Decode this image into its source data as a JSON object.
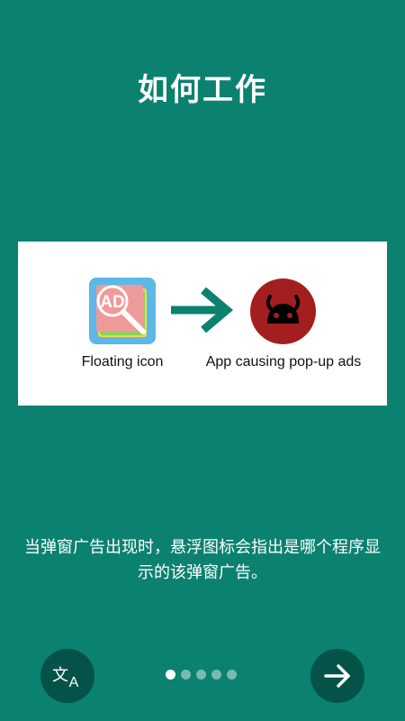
{
  "header": {
    "title": "如何工作"
  },
  "illustration": {
    "floating_icon_label": "Floating icon",
    "floating_icon_text": "AD",
    "app_label": "App causing pop-up ads"
  },
  "description": "当弹窗广告出现时，悬浮图标会指出是哪个程序显示的该弹窗广告。",
  "footer": {
    "translate_icon": "translate-icon",
    "next_icon": "arrow-right-icon",
    "page_indicator": {
      "total": 5,
      "current": 1
    }
  },
  "colors": {
    "background": "#0b8170",
    "button": "#055348",
    "arrow": "#0b8170",
    "app_icon": "#a31f1f"
  }
}
